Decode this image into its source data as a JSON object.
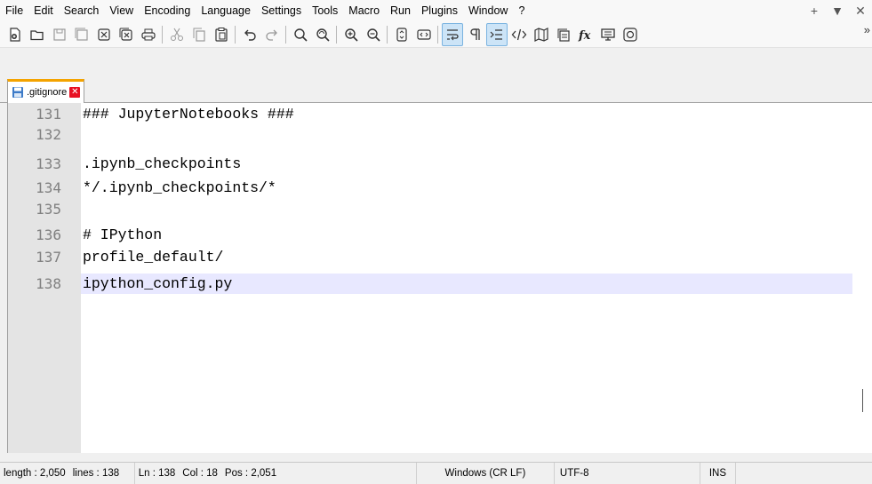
{
  "menu": {
    "items": [
      "File",
      "Edit",
      "Search",
      "View",
      "Encoding",
      "Language",
      "Settings",
      "Tools",
      "Macro",
      "Run",
      "Plugins",
      "Window",
      "?"
    ],
    "add": "+",
    "dropdown": "▼",
    "close": "✕"
  },
  "toolbar": {
    "buttons": [
      "new-file-icon",
      "open-file-icon",
      "save-icon",
      "save-all-icon",
      "close-icon",
      "close-all-icon",
      "print-icon",
      "cut-icon",
      "copy-icon",
      "paste-icon",
      "undo-icon",
      "redo-icon",
      "find-icon",
      "replace-icon",
      "zoom-in-icon",
      "zoom-out-icon",
      "sync-vertical-icon",
      "sync-horizontal-icon",
      "word-wrap-icon",
      "show-all-chars-icon",
      "indent-guide-icon",
      "xml-icon",
      "map-icon",
      "document-list-icon",
      "function-list-icon",
      "monitor-icon",
      "record-icon"
    ],
    "more": "»",
    "active": [
      "word-wrap-icon",
      "indent-guide-icon"
    ]
  },
  "tab": {
    "label": ".gitignore",
    "close": "✕"
  },
  "editor": {
    "lines": [
      {
        "no": "131",
        "text": "### JupyterNotebooks ###"
      },
      {
        "no": "132",
        "text": ""
      },
      {
        "no": "133",
        "text": ".ipynb_checkpoints"
      },
      {
        "no": "134",
        "text": "*/.ipynb_checkpoints/*"
      },
      {
        "no": "135",
        "text": ""
      },
      {
        "no": "136",
        "text": "# IPython"
      },
      {
        "no": "137",
        "text": "profile_default/"
      },
      {
        "no": "138",
        "text": "ipython_config.py"
      }
    ],
    "current_line": "138"
  },
  "status": {
    "length": "length : 2,050",
    "lines": "lines : 138",
    "ln": "Ln : 138",
    "col": "Col : 18",
    "pos": "Pos : 2,051",
    "eol": "Windows (CR LF)",
    "encoding": "UTF-8",
    "mode": "INS"
  }
}
